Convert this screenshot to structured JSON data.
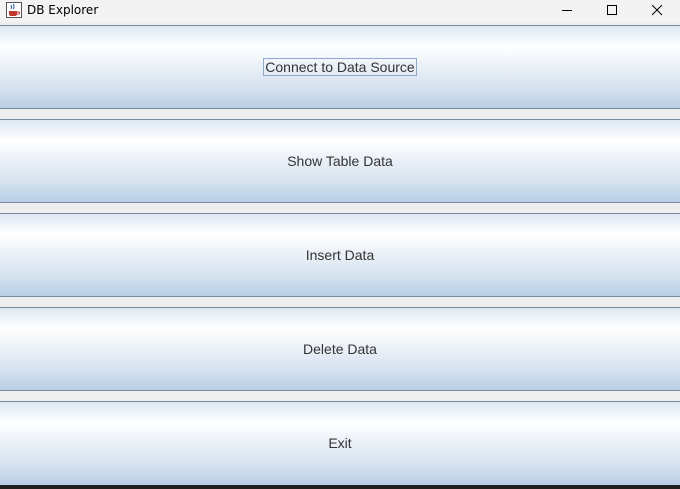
{
  "window": {
    "title": "DB Explorer",
    "app_icon": "java-coffee-cup-icon",
    "controls": [
      "minimize-icon",
      "maximize-icon",
      "close-icon"
    ]
  },
  "buttons": [
    {
      "label": "Connect to Data Source",
      "focused": true
    },
    {
      "label": "Show Table Data",
      "focused": false
    },
    {
      "label": "Insert Data",
      "focused": false
    },
    {
      "label": "Delete Data",
      "focused": false
    },
    {
      "label": "Exit",
      "focused": false
    }
  ],
  "colors": {
    "button_gradient_top": "#ffffff",
    "button_gradient_bottom": "#b8cfe5",
    "button_border": "#7a8a99",
    "focus_ring": "#8faacb",
    "background": "#eeeeee"
  }
}
